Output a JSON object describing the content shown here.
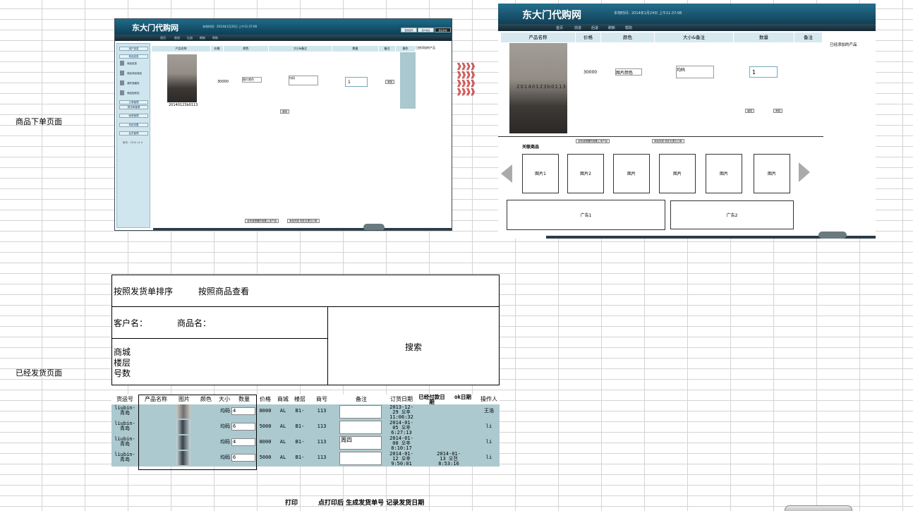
{
  "labels": {
    "order_page": "商品下单页面",
    "shipped_page": "已经发货页面"
  },
  "shot1": {
    "logo": "东大门代购网",
    "time": "本地时间：2014年1月26日 上午11:37:08",
    "top_buttons": [
      "更改密码",
      "用户信息",
      "退出系统"
    ],
    "nav": [
      "首页",
      "前进",
      "后退",
      "刷新",
      "帮助"
    ],
    "sidebar": {
      "headers": [
        "用户信息",
        "商品信息"
      ],
      "items": [
        "商品信息",
        "商品添加商品",
        "我的收藏夹",
        "商品回收站"
      ],
      "sections": [
        "订单管理",
        "物流单管理",
        "帐单管理",
        "系统设置",
        "会员管理"
      ],
      "version": "版本：2014 v1.0"
    },
    "columns": [
      "产品名称",
      "价格",
      "颜色",
      "大小&备注",
      "数量",
      "备注",
      "操作"
    ],
    "right_title": "已经添加的产品",
    "row": {
      "caption": "20140123b0113",
      "price": "30000",
      "color": "图片颜色",
      "size": "均码",
      "qty": "1",
      "action": "添加"
    },
    "back": "返回",
    "bottom_buttons": [
      "没有我想要的就要上传产品",
      "添加完成 现在去提交订单"
    ]
  },
  "arrows": "》》》》\n》》》》\n》》》》\n》》》》",
  "shot2": {
    "logo": "东大门代购网",
    "time": "本地时间：2014年1月24日 上午11:37:08",
    "nav": [
      "首页",
      "前进",
      "后退",
      "刷新",
      "帮助"
    ],
    "columns": [
      "产品名称",
      "价格",
      "颜色",
      "大小&备注",
      "数量",
      "备注"
    ],
    "right_title": "已经添加的产品",
    "row": {
      "caption": "20140123b0113",
      "price": "30000",
      "color": "图片颜色",
      "size": "均码",
      "qty": "1"
    },
    "back": "返回",
    "add": "添加",
    "upload": "没有我想要的就要上传产品",
    "submit": "添加完成 现在去提交订单",
    "related": "关联商品",
    "pics": [
      "图片1",
      "图片2",
      "图片",
      "图片",
      "图片",
      "图片"
    ],
    "ads": [
      "广告1",
      "广告2"
    ]
  },
  "panel": {
    "sort_by_order": "按照发货单排序",
    "sort_by_product": "按照商品查看",
    "customer": "客户名：",
    "product": "商品名：",
    "mall": "商城",
    "floor": "楼层",
    "number": "号数",
    "search": "搜索"
  },
  "table": {
    "headers": [
      "货运号",
      "产品名称",
      "图片",
      "颜色",
      "大小",
      "数量",
      "价格",
      "商城",
      "楼层",
      "商号",
      "备注",
      "订货日期",
      "已经付款日期",
      "ok日期",
      "操作人"
    ],
    "rows": [
      {
        "ship": "liubin-\n青岛",
        "size": "均码",
        "qty": "4",
        "price": "8000",
        "mall": "AL",
        "floor": "B1-",
        "no": "113",
        "note": "",
        "date": "2013-12-\n29 오후\n11:06:32",
        "paid": "",
        "ok": "",
        "op": "王浩"
      },
      {
        "ship": "liubin-\n青岛",
        "size": "均码",
        "qty": "6",
        "price": "5000",
        "mall": "AL",
        "floor": "B1-",
        "no": "113",
        "note": "",
        "date": "2014-01-\n05 오후\n6:27:13",
        "paid": "",
        "ok": "",
        "op": "li"
      },
      {
        "ship": "liubin-\n青岛",
        "size": "均码",
        "qty": "4",
        "price": "8000",
        "mall": "AL",
        "floor": "B1-",
        "no": "113",
        "note": "周四",
        "date": "2014-01-\n08 오후\n8:10:17",
        "paid": "",
        "ok": "",
        "op": "li"
      },
      {
        "ship": "liubin-\n青岛",
        "size": "均码",
        "qty": "6",
        "price": "5000",
        "mall": "AL",
        "floor": "B1-",
        "no": "113",
        "note": "",
        "date": "2014-01-\n12 오후\n9:50:01",
        "paid": "2014-01-\n13 오전\n8:53:16",
        "ok": "",
        "op": "li"
      }
    ]
  },
  "footer": {
    "print": "打印",
    "after_print": "点打印后  生成发货单号  记录发货日期"
  }
}
